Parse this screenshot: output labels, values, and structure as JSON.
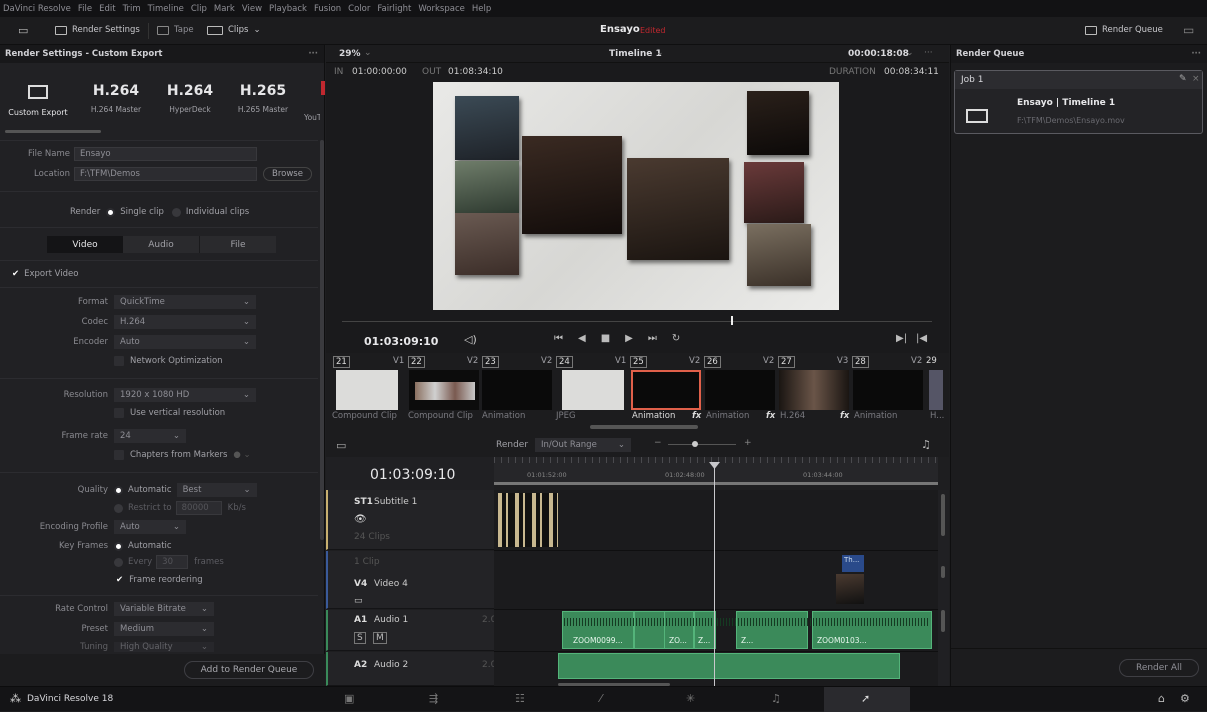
{
  "menu": [
    "DaVinci Resolve",
    "File",
    "Edit",
    "Trim",
    "Timeline",
    "Clip",
    "Mark",
    "View",
    "Playback",
    "Fusion",
    "Color",
    "Fairlight",
    "Workspace",
    "Help"
  ],
  "toolbar": {
    "render_settings": "Render Settings",
    "tape": "Tape",
    "clips": "Clips",
    "project": "Ensayo",
    "status": "Edited",
    "render_queue": "Render Queue"
  },
  "render_settings": {
    "title": "Render Settings - Custom Export",
    "presets": [
      {
        "big": "",
        "small": "Custom Export"
      },
      {
        "big": "H.264",
        "small": "H.264 Master"
      },
      {
        "big": "H.264",
        "small": "HyperDeck"
      },
      {
        "big": "H.265",
        "small": "H.265 Master"
      },
      {
        "big": "",
        "small": "YouTu"
      }
    ],
    "file_name_label": "File Name",
    "file_name": "Ensayo",
    "location_label": "Location",
    "location": "F:\\TFM\\Demos",
    "browse": "Browse",
    "render_label": "Render",
    "single_clip": "Single clip",
    "individual_clips": "Individual clips",
    "tabs": [
      "Video",
      "Audio",
      "File"
    ],
    "export_video": "Export Video",
    "format_label": "Format",
    "format": "QuickTime",
    "codec_label": "Codec",
    "codec": "H.264",
    "encoder_label": "Encoder",
    "encoder": "Auto",
    "network_opt": "Network Optimization",
    "resolution_label": "Resolution",
    "resolution": "1920 x 1080 HD",
    "vertical_res": "Use vertical resolution",
    "frame_rate_label": "Frame rate",
    "frame_rate": "24",
    "chapters": "Chapters from Markers",
    "quality_label": "Quality",
    "quality_auto": "Automatic",
    "quality_value": "Best",
    "restrict_to": "Restrict to",
    "restrict_value": "80000",
    "restrict_unit": "Kb/s",
    "encoding_profile_label": "Encoding Profile",
    "encoding_profile": "Auto",
    "key_frames_label": "Key Frames",
    "kf_auto": "Automatic",
    "kf_every": "Every",
    "kf_value": "30",
    "kf_unit": "frames",
    "frame_reordering": "Frame reordering",
    "rate_control_label": "Rate Control",
    "rate_control": "Variable Bitrate",
    "preset_label": "Preset",
    "preset": "Medium",
    "tuning_label": "Tuning",
    "tuning": "High Quality",
    "add_to_queue": "Add to Render Queue"
  },
  "viewer": {
    "zoom": "29%",
    "timeline": "Timeline 1",
    "tc_top": "00:00:18:08",
    "in_label": "IN",
    "in_tc": "01:00:00:00",
    "out_label": "OUT",
    "out_tc": "01:08:34:10",
    "duration_label": "DURATION",
    "duration": "00:08:34:11",
    "current_tc": "01:03:09:10"
  },
  "clips": [
    {
      "num": "21",
      "track": "V1",
      "label": "Compound Clip"
    },
    {
      "num": "22",
      "track": "V2",
      "label": "Compound Clip"
    },
    {
      "num": "23",
      "track": "V2",
      "label": "Animation"
    },
    {
      "num": "24",
      "track": "V1",
      "label": "JPEG"
    },
    {
      "num": "25",
      "track": "V2",
      "label": "Animation"
    },
    {
      "num": "26",
      "track": "V2",
      "label": "Animation"
    },
    {
      "num": "27",
      "track": "V3",
      "label": "H.264"
    },
    {
      "num": "28",
      "track": "V2",
      "label": "Animation"
    },
    {
      "num": "29",
      "track": "",
      "label": "H..."
    }
  ],
  "timeline": {
    "render_label": "Render",
    "range": "In/Out Range",
    "tc": "01:03:09:10",
    "ruler": [
      "01:01:52:00",
      "01:02:48:00",
      "01:03:44:00"
    ],
    "tracks": [
      {
        "id": "ST1",
        "name": "Subtitle 1",
        "info": "24 Clips"
      },
      {
        "id": "V4",
        "name": "Video 4",
        "info": "1 Clip"
      },
      {
        "id": "A1",
        "name": "Audio 1",
        "level": "2.0"
      },
      {
        "id": "A2",
        "name": "Audio 2",
        "level": "2.0"
      }
    ],
    "clip_labels": [
      "ZOOM0099...",
      "ZO...",
      "Z...",
      "Z...",
      "ZOOM0103...",
      "Th..."
    ],
    "solo": "S",
    "mute": "M"
  },
  "render_queue": {
    "title": "Render Queue",
    "job": "Job 1",
    "job_title": "Ensayo | Timeline 1",
    "job_path": "F:\\TFM\\Demos\\Ensayo.mov",
    "render_all": "Render All"
  },
  "bottom": {
    "app": "DaVinci Resolve 18"
  }
}
